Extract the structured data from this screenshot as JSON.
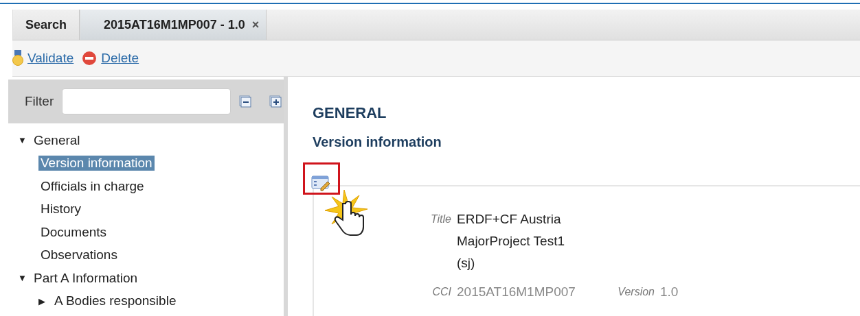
{
  "tabs": [
    {
      "label": "Search",
      "selected": false
    },
    {
      "label": "2015AT16M1MP007 - 1.0",
      "selected": true,
      "close": "×"
    }
  ],
  "toolbar": [
    {
      "kind": "validate",
      "label": "Validate"
    },
    {
      "kind": "delete",
      "label": "Delete"
    }
  ],
  "filter": {
    "label": "Filter"
  },
  "tree": [
    {
      "label": "General",
      "toggle": "▼",
      "selected": false,
      "children": [
        {
          "label": "Version information",
          "selected": true
        },
        {
          "label": "Officials in charge",
          "selected": false
        },
        {
          "label": "History",
          "selected": false
        },
        {
          "label": "Documents",
          "selected": false
        },
        {
          "label": "Observations",
          "selected": false
        }
      ]
    },
    {
      "label": "Part A Information",
      "toggle": "▼",
      "selected": false,
      "children": [
        {
          "label": "A Bodies responsible",
          "toggle": "▶",
          "selected": false
        }
      ]
    }
  ],
  "content": {
    "section": "GENERAL",
    "subtitle": "Version information",
    "edit_highlighted": true,
    "rows": [
      [
        {
          "label": "Title",
          "value": "ERDF+CF Austria MajorProject Test1 (sj)",
          "dim": false
        }
      ],
      [
        {
          "label": "CCI",
          "value": "2015AT16M1MP007",
          "dim": true
        },
        {
          "label": "Version",
          "value": "1.0",
          "dim": true
        }
      ]
    ]
  }
}
